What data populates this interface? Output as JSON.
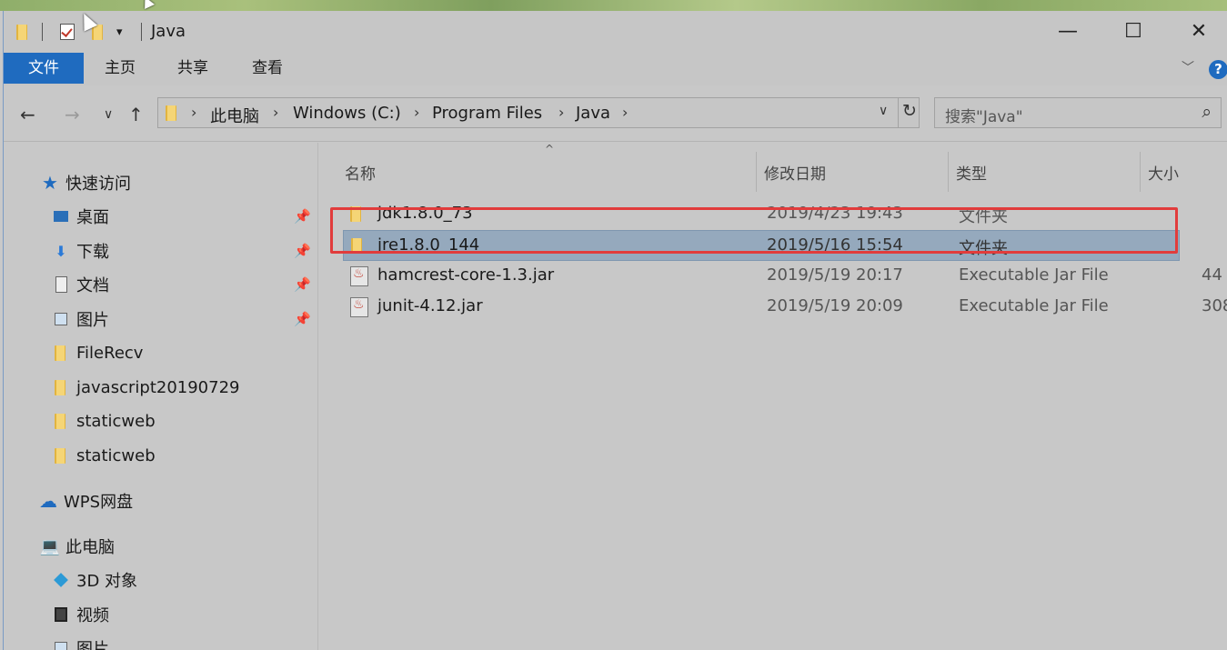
{
  "window": {
    "title": "Java",
    "minimize_glyph": "—",
    "maximize_glyph": "☐",
    "close_glyph": "✕"
  },
  "ribbon": {
    "tabs": [
      {
        "label": "文件"
      },
      {
        "label": "主页"
      },
      {
        "label": "共享"
      },
      {
        "label": "查看"
      }
    ],
    "help_label": "?"
  },
  "address": {
    "crumbs": [
      "此电脑",
      "Windows (C:)",
      "Program Files",
      "Java"
    ]
  },
  "search": {
    "placeholder": "搜索\"Java\""
  },
  "nav_pane": {
    "quick_access_label": "快速访问",
    "quick_items": [
      {
        "label": "桌面",
        "pinned": true
      },
      {
        "label": "下载",
        "pinned": true
      },
      {
        "label": "文档",
        "pinned": true
      },
      {
        "label": "图片",
        "pinned": true
      },
      {
        "label": "FileRecv",
        "pinned": false
      },
      {
        "label": "javascript20190729",
        "pinned": false
      },
      {
        "label": "staticweb",
        "pinned": false
      },
      {
        "label": "staticweb",
        "pinned": false
      }
    ],
    "wps_label": "WPS网盘",
    "pc_label": "此电脑",
    "pc_items": [
      {
        "label": "3D 对象"
      },
      {
        "label": "视频"
      },
      {
        "label": "图片"
      }
    ]
  },
  "file_list": {
    "columns": {
      "name": "名称",
      "modified": "修改日期",
      "type": "类型",
      "size": "大小"
    },
    "rows": [
      {
        "name": "jdk1.8.0_73",
        "modified": "2019/4/23 19:43",
        "type": "文件夹",
        "size": "",
        "kind": "folder"
      },
      {
        "name": "jre1.8.0_144",
        "modified": "2019/5/16 15:54",
        "type": "文件夹",
        "size": "",
        "kind": "folder",
        "selected": true
      },
      {
        "name": "hamcrest-core-1.3.jar",
        "modified": "2019/5/19 20:17",
        "type": "Executable Jar File",
        "size": "44",
        "kind": "jar"
      },
      {
        "name": "junit-4.12.jar",
        "modified": "2019/5/19 20:09",
        "type": "Executable Jar File",
        "size": "308",
        "kind": "jar"
      }
    ]
  },
  "colors": {
    "accent": "#1f6bbf",
    "selection": "#95a9bd",
    "highlight_box": "#e13c3c"
  }
}
